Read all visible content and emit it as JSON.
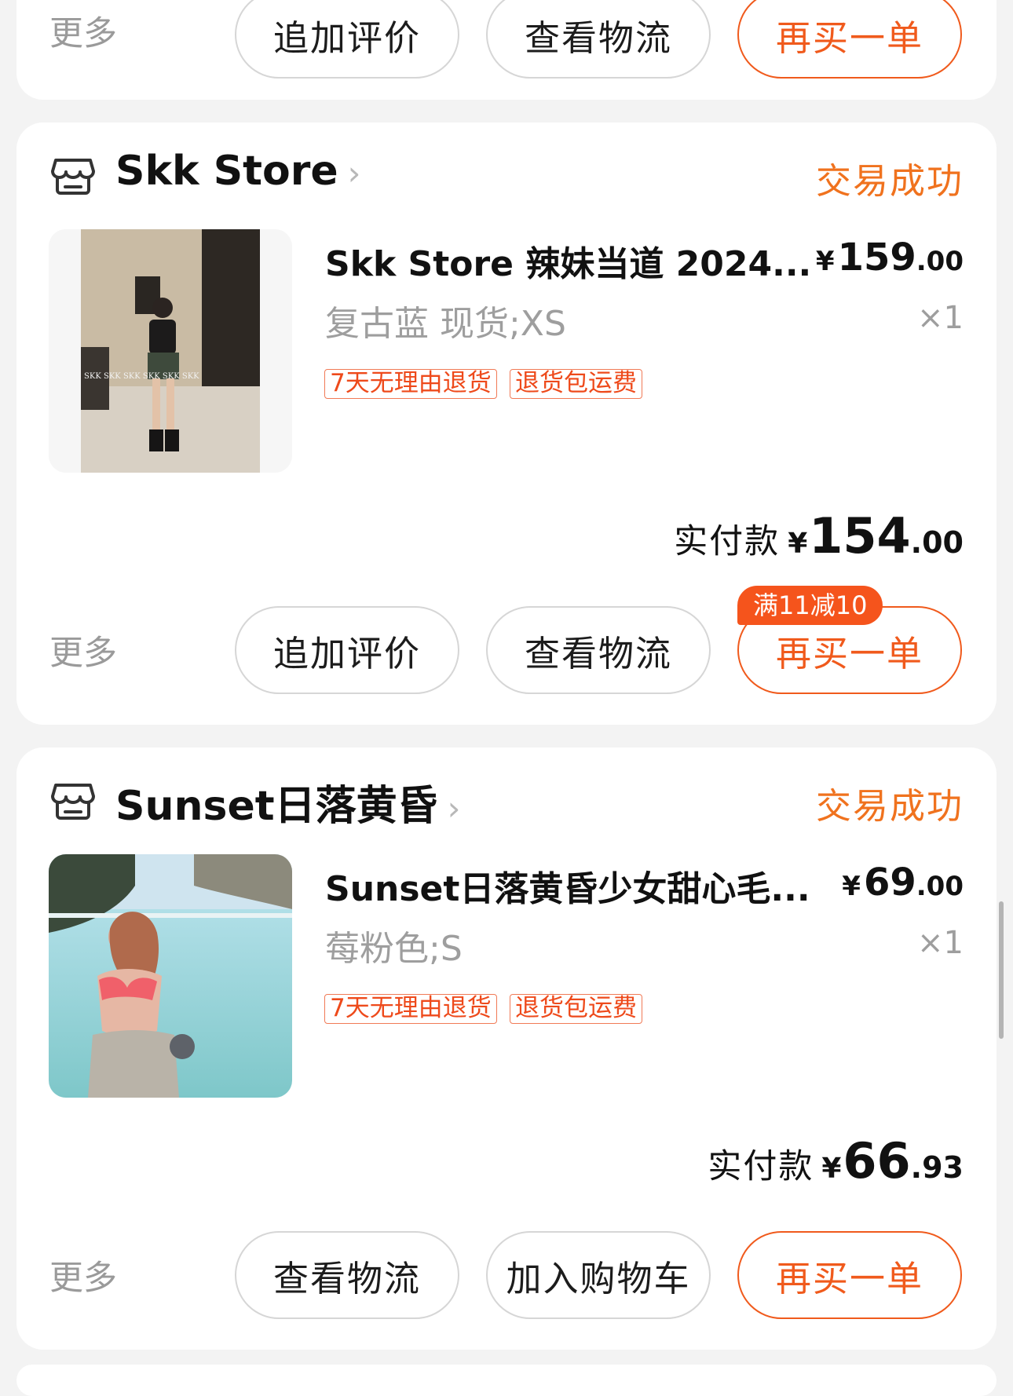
{
  "top_card": {
    "more": "更多",
    "buttons": [
      "追加评价",
      "查看物流",
      "再买一单"
    ]
  },
  "orders": [
    {
      "shop": "Skk Store",
      "status": "交易成功",
      "title": "Skk Store 辣妹当道 2024...",
      "price_currency": "¥",
      "price_int": "159",
      "price_dec": ".00",
      "sku": "复古蓝 现货;XS",
      "qty": "×1",
      "tags": [
        "7天无理由退货",
        "退货包运费"
      ],
      "paid_label": "实付款",
      "paid_currency": "¥",
      "paid_int": "154",
      "paid_dec": ".00",
      "promo": "满11减10",
      "more": "更多",
      "buttons": [
        "追加评价",
        "查看物流",
        "再买一单"
      ],
      "watermark": "SKK   SKK   SKK   SKK   SKK   SKK"
    },
    {
      "shop": "Sunset日落黄昏",
      "status": "交易成功",
      "title": "Sunset日落黄昏少女甜心毛...",
      "price_currency": "¥",
      "price_int": "69",
      "price_dec": ".00",
      "sku": "莓粉色;S",
      "qty": "×1",
      "tags": [
        "7天无理由退货",
        "退货包运费"
      ],
      "paid_label": "实付款",
      "paid_currency": "¥",
      "paid_int": "66",
      "paid_dec": ".93",
      "more": "更多",
      "buttons": [
        "查看物流",
        "加入购物车",
        "再买一单"
      ]
    }
  ],
  "icons": {
    "shop": "shop-icon",
    "chevron": "chevron-right-icon"
  },
  "colors": {
    "accent_orange": "#f05a1c",
    "status_orange": "#f0721e",
    "promo_bg": "#f5541c",
    "background": "#f3f3f3"
  }
}
